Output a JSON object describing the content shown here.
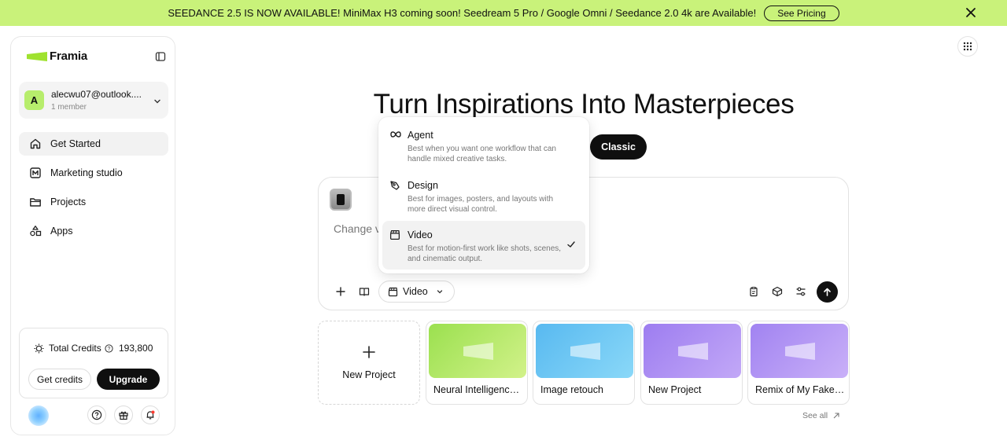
{
  "banner": {
    "message": "SEEDANCE 2.5 IS NOW AVAILABLE! MiniMax H3 coming soon! Seedream 5 Pro / Google Omni / Seedance 2.0 4k are Available!",
    "cta": "See Pricing"
  },
  "sidebar": {
    "brand": "Framia",
    "account": {
      "initial": "A",
      "email": "alecwu07@outlook....",
      "members": "1 member"
    },
    "nav": [
      {
        "label": "Get Started",
        "icon": "home-icon"
      },
      {
        "label": "Marketing studio",
        "icon": "m-box-icon"
      },
      {
        "label": "Projects",
        "icon": "folder-icon"
      },
      {
        "label": "Apps",
        "icon": "apps-icon"
      }
    ],
    "credits": {
      "label": "Total Credits",
      "value": "193,800",
      "get_label": "Get credits",
      "upgrade_label": "Upgrade"
    }
  },
  "main": {
    "title": "Turn Inspirations Into Masterpieces",
    "classic_label": "Classic",
    "composer": {
      "prompt_text": "Change vi",
      "mode_label": "Video"
    },
    "mode_menu": [
      {
        "title": "Agent",
        "desc": "Best when you want one workflow that can handle mixed creative tasks.",
        "icon": "infinity-icon",
        "selected": false
      },
      {
        "title": "Design",
        "desc": "Best for images, posters, and layouts with more direct visual control.",
        "icon": "pen-tool-icon",
        "selected": false
      },
      {
        "title": "Video",
        "desc": "Best for motion-first work like shots, scenes, and cinematic output.",
        "icon": "clapperboard-icon",
        "selected": true
      }
    ],
    "new_project_label": "New Project",
    "projects": [
      {
        "label": "Neural Intelligence Ne...",
        "color_from": "#d2f28a",
        "color_to": "#9be04f"
      },
      {
        "label": "Image retouch",
        "color_from": "#8ad8f8",
        "color_to": "#58b9f0"
      },
      {
        "label": "New Project",
        "color_from": "#c2a8f7",
        "color_to": "#9d7df0"
      },
      {
        "label": "Remix of My Fake Exp...",
        "color_from": "#c9b0f8",
        "color_to": "#a183f1"
      }
    ],
    "see_all_label": "See all"
  }
}
